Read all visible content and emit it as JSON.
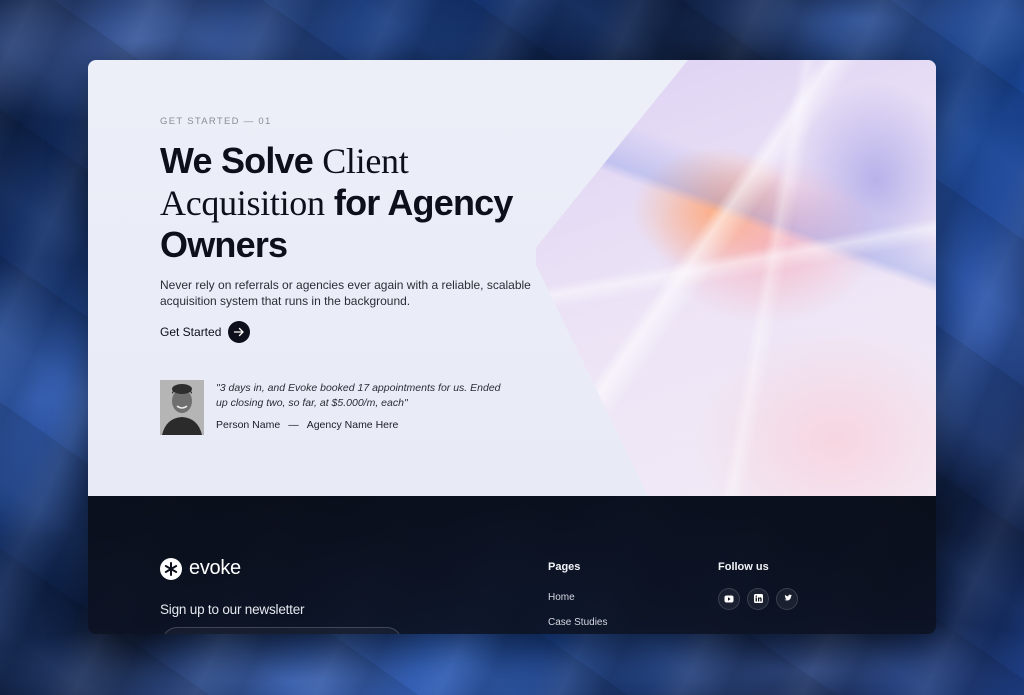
{
  "hero": {
    "eyebrow": "GET STARTED — 01",
    "headline": {
      "part1": "We Solve ",
      "part2_serif": "Client",
      "part3_serif": "Acquisition",
      "part4": " for Agency",
      "part5": "Owners"
    },
    "subtext": "Never rely on referrals or agencies ever again with a reliable, scalable acquisition system that runs in the background.",
    "cta_label": "Get Started",
    "cta_icon": "arrow-right-icon"
  },
  "testimonial": {
    "quote": "\"3 days in, and Evoke booked 17 appointments for us. Ended up closing two, so far, at $5.000/m, each\"",
    "person_name": "Person Name",
    "separator": "—",
    "agency_name": "Agency Name Here"
  },
  "footer": {
    "brand": "evoke",
    "brand_icon": "asterisk-icon",
    "newsletter_label": "Sign up to our newsletter",
    "pages": {
      "title": "Pages",
      "links": [
        "Home",
        "Case Studies"
      ]
    },
    "follow": {
      "title": "Follow us",
      "icons": [
        "youtube-icon",
        "linkedin-icon",
        "twitter-icon"
      ]
    }
  },
  "colors": {
    "hero_bg": "#eceef8",
    "ink": "#0d0f1a",
    "footer_bg": "#0a0e1a",
    "background_blue": "#16387a"
  }
}
